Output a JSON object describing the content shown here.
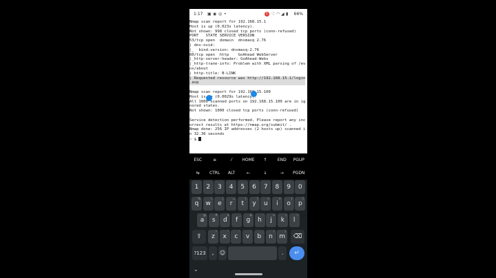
{
  "status_bar": {
    "time": "1:17",
    "badge_count": "1",
    "battery": "66%"
  },
  "terminal": {
    "lines": [
      "Nmap scan report for 192.168.15.1",
      "Host is up (0.023s latency).",
      "Not shown: 998 closed tcp ports (conn-refused)",
      "PORT   STATE SERVICE VERSION",
      "53/tcp open  domain  dnsmasq 2.76",
      "| dns-nsid:",
      "|_  bind.version: dnsmasq-2.76",
      "80/tcp open  http    GoAhead WebServer",
      "|_http-server-header: GoAhead-Webs",
      "|_http-trane-info: Problem with XML parsing of /ev",
      "ox/about",
      "| http-title: B-LINK",
      "| Requested resource was http://192.168.15.1/login",
      ".asp",
      "",
      "Nmap scan report for 192.168.15.100",
      "Host is up (0.0029s latency).",
      "All 1000 scanned ports on 192.168.15.100 are in ig",
      "nored states.",
      "Not shown: 1000 closed tcp ports (conn-refused)",
      "",
      "Service detection performed. Please report any inc",
      "orrect results at https://nmap.org/submit/ .",
      "Nmap done: 256 IP addresses (2 hosts up) scanned i",
      "n 32.36 seconds"
    ],
    "prompt": "~ $ "
  },
  "extra_keys": {
    "row1": [
      "ESC",
      "≡",
      "⁄",
      "HOME",
      "↑",
      "END",
      "PGUP"
    ],
    "row2": [
      "⇆",
      "CTRL",
      "ALT",
      "←",
      "↓",
      "→",
      "PGDN"
    ]
  },
  "keyboard": {
    "numbers": [
      "1",
      "2",
      "3",
      "4",
      "5",
      "6",
      "7",
      "8",
      "9",
      "0"
    ],
    "row_q": [
      "q",
      "w",
      "e",
      "r",
      "t",
      "y",
      "u",
      "i",
      "o",
      "p"
    ],
    "row_q_sub": [
      "%",
      "\\",
      "|",
      "=",
      "[",
      "]",
      "<",
      ">",
      "{",
      "}"
    ],
    "row_a": [
      "a",
      "s",
      "d",
      "f",
      "g",
      "h",
      "j",
      "k",
      "l"
    ],
    "row_a_sub": [
      "@",
      "#",
      "$",
      "_",
      "&",
      "-",
      "+",
      "(",
      ")"
    ],
    "row_z": [
      "z",
      "x",
      "c",
      "v",
      "b",
      "n",
      "m"
    ],
    "row_z_sub": [
      "*",
      "\"",
      "'",
      ":",
      ";",
      "!",
      "?"
    ],
    "shift": "⇧",
    "backspace": "⌫",
    "symbols": "?123",
    "comma": ",",
    "emoji": "☺",
    "period": ".",
    "enter": "↵",
    "collapse": "⌄"
  },
  "colors": {
    "accent": "#4a8ff0",
    "touch": "#1e88e5",
    "keyboard_bg": "#1d2225",
    "key_bg": "#3b4145"
  }
}
